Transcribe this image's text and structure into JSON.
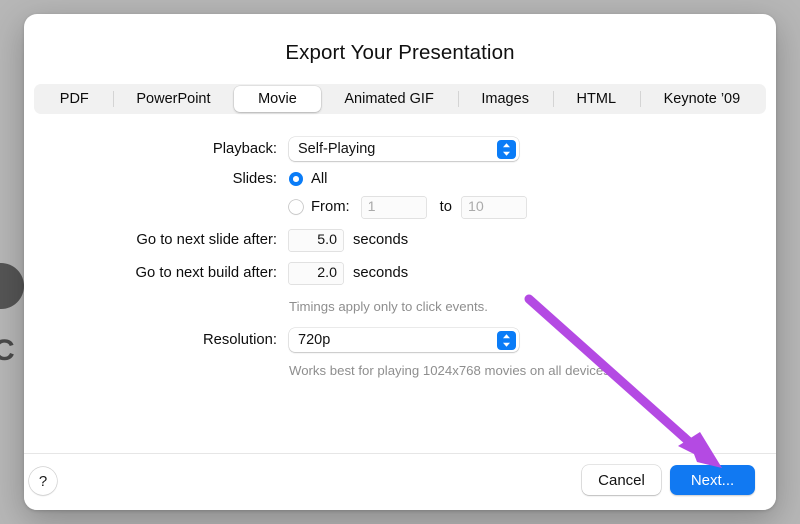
{
  "dialog": {
    "title": "Export Your Presentation",
    "tabs": [
      {
        "label": "PDF",
        "selected": false
      },
      {
        "label": "PowerPoint",
        "selected": false
      },
      {
        "label": "Movie",
        "selected": true
      },
      {
        "label": "Animated GIF",
        "selected": false
      },
      {
        "label": "Images",
        "selected": false
      },
      {
        "label": "HTML",
        "selected": false
      },
      {
        "label": "Keynote ’09",
        "selected": false
      }
    ],
    "form": {
      "playback": {
        "label": "Playback:",
        "value": "Self-Playing",
        "chevron_icon": "chevron-up-down-icon"
      },
      "slides": {
        "label": "Slides:",
        "all_option_label": "All",
        "all_selected": true,
        "range_option_label": "From:",
        "range_selected": false,
        "from_value": "1",
        "to_label": "to",
        "to_value": "10"
      },
      "next_slide": {
        "label": "Go to next slide after:",
        "value": "5.0",
        "unit": "seconds"
      },
      "next_build": {
        "label": "Go to next build after:",
        "value": "2.0",
        "unit": "seconds"
      },
      "timings_note": "Timings apply only to click events.",
      "resolution": {
        "label": "Resolution:",
        "value": "720p",
        "chevron_icon": "chevron-up-down-icon",
        "note": "Works best for playing 1024x768 movies on all devices."
      }
    },
    "footer": {
      "help_label": "?",
      "cancel_label": "Cancel",
      "next_label": "Next..."
    }
  },
  "background": {
    "glyph": "C"
  },
  "colors": {
    "accent_blue": "#0a7cf7",
    "primary_button": "#1179f2",
    "annotation_purple": "#b44ae3",
    "tabbar_track": "#f1f1f1",
    "hint_text": "#8e8e8e",
    "desktop": "#b7b7b7"
  }
}
